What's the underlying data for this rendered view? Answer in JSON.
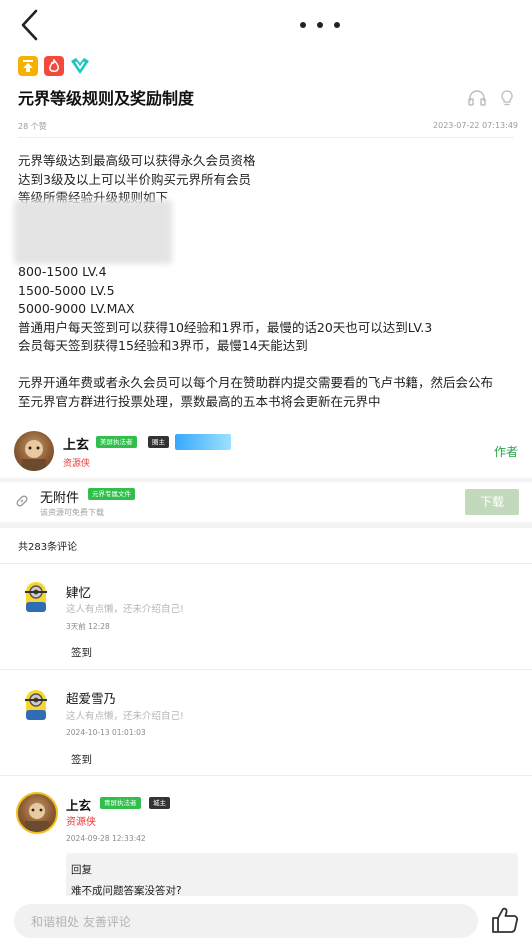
{
  "header": {
    "back_icon": "back-chevron-icon",
    "more_icon": "more-dots-icon"
  },
  "post": {
    "title": "元界等级规则及奖励制度",
    "tags": [
      "pin-icon",
      "hot-icon",
      "vip-icon"
    ],
    "likes": "28 个赞",
    "datetime": "2023-07-22 07:13:49",
    "lines_top": [
      "元界等级达到最高级可以获得永久会员资格",
      "达到3级及以上可以半价购买元界所有会员",
      "等级所需经验升级规则如下"
    ],
    "lines_bottom": [
      "800-1500 LV.4",
      "1500-5000 LV.5",
      "5000-9000 LV.MAX",
      "普通用户每天签到可以获得10经验和1界币，最慢的话20天也可以达到LV.3",
      "会员每天签到获得15经验和3界币，最慢14天能达到",
      "",
      "元界开通年费或者永久会员可以每个月在赞助群内提交需要看的飞卢书籍，然后会公布",
      "至元界官方群进行投票处理，票数最高的五本书将会更新在元界中"
    ]
  },
  "author": {
    "name": "上玄",
    "badge_enforcer": "美屏执法者",
    "badge_owner": "圈主",
    "subtitle": "资源侠",
    "role_label": "作者"
  },
  "attachment": {
    "title": "无附件",
    "badge": "元界专属文件",
    "note": "该资源可免费下载",
    "download_label": "下载"
  },
  "comments_header": "共283条评论",
  "comments": [
    {
      "name": "肄忆",
      "intro": "这人有点懒，还未介绍自己!",
      "time": "3天前 12:28",
      "text": "签到"
    },
    {
      "name": "超爱雪乃",
      "intro": "这人有点懒，还未介绍自己!",
      "time": "2024-10-13 01:01:03",
      "text": "签到"
    },
    {
      "name": "上玄",
      "badge_enforcer": "青屏执法者",
      "badge_owner": "城主",
      "subtitle": "资源侠",
      "time": "2024-09-28 12:33:42",
      "reply_label": "回复",
      "reply_text": "难不成问题答案没答对?"
    }
  ],
  "bottom": {
    "placeholder": "和谐相处 友善评论",
    "like_icon": "thumbs-up-icon"
  },
  "colors": {
    "accent_green": "#2fbf4a",
    "red": "#e93a3a",
    "download_bg": "#c3d9bc"
  }
}
